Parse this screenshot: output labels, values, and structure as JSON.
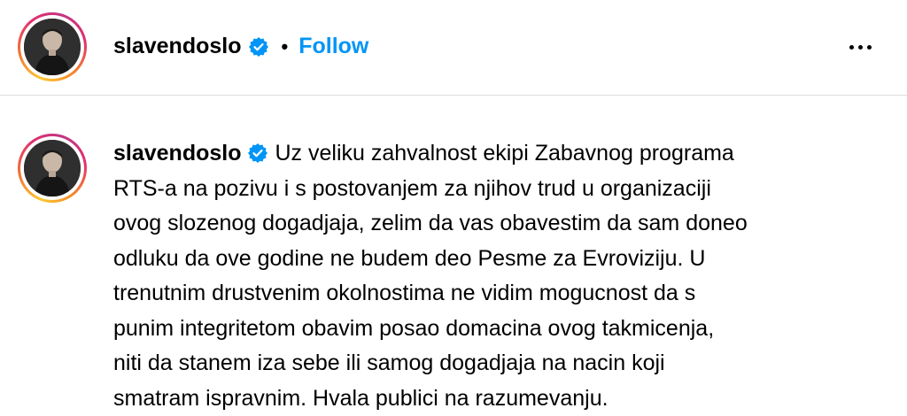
{
  "post_header": {
    "username": "slavendoslo",
    "verified_icon": "verified-badge-icon",
    "separator": "•",
    "follow_label": "Follow",
    "more_icon": "more-options-icon"
  },
  "caption": {
    "username": "slavendoslo",
    "lines": [
      "Uz veliku zahvalnost ekipi Zabavnog programa",
      "RTS-a na pozivu i s postovanjem za njihov trud u organizaciji",
      "ovog slozenog dogadjaja, zelim da vas obavestim da sam doneo",
      "odluku da ove godine ne budem deo Pesme za Evroviziju. U",
      "trenutnim drustvenim okolnostima ne vidim mogucnost da s",
      "punim integritetom obavim posao domacina ovog takmicenja,",
      "niti da stanem iza sebe ili samog dogadjaja na nacin koji",
      "smatram ispravnim. Hvala publici na razumevanju."
    ]
  },
  "colors": {
    "follow": "#0095f6",
    "verified": "#0095f6",
    "divider": "#dbdbdb"
  }
}
